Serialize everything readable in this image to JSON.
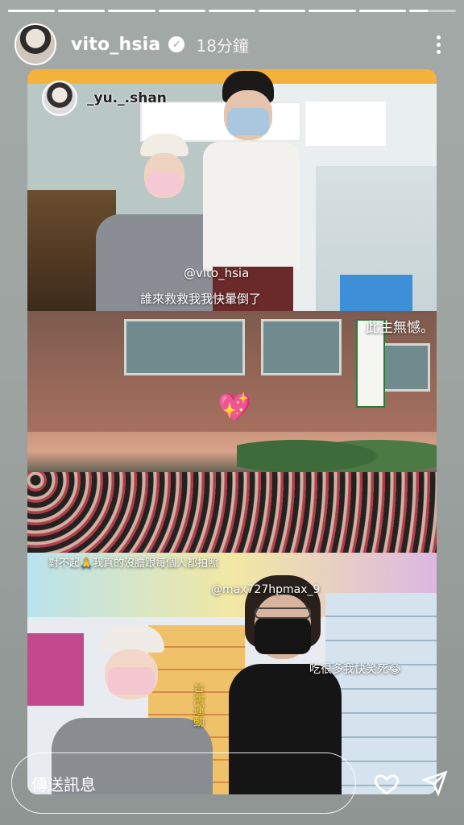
{
  "progress": {
    "segments": 9,
    "active_index": 8
  },
  "header": {
    "username": "vito_hsia",
    "verified_icon": "verified-icon",
    "time": "18分鐘",
    "more_icon": "more-icon"
  },
  "collage": {
    "photo1": {
      "mention": "_yu._.shan",
      "tag": "@vito_hsia",
      "caption": "誰來救救我我快暈倒了"
    },
    "photo2": {
      "caption_top": "此生無憾。",
      "caption_bottom": "對不起🙏我真的沒膽跟每個人都拍照",
      "sticker_icon": "sparkling-heart-icon"
    },
    "photo3": {
      "mention": "@max727hpmax_9",
      "caption": "吃很多我快笑死😂",
      "vertical_text": "台灣運動"
    }
  },
  "footer": {
    "message_placeholder": "傳送訊息",
    "like_icon": "heart-icon",
    "share_icon": "send-icon"
  }
}
